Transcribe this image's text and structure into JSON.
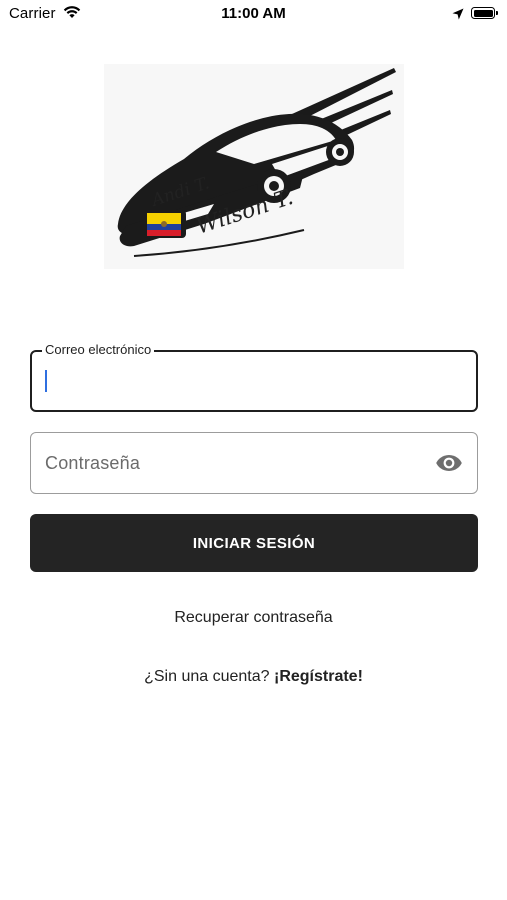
{
  "status_bar": {
    "carrier": "Carrier",
    "time": "11:00 AM",
    "icons": [
      "wifi-icon",
      "location-arrow-icon",
      "battery-icon"
    ]
  },
  "logo": {
    "line1": "Andi T.",
    "line2": "Wilson T.",
    "flag_colors": [
      "#f5d000",
      "#1f3f9c",
      "#d81e2a"
    ]
  },
  "form": {
    "email": {
      "label": "Correo electrónico",
      "value": ""
    },
    "password": {
      "placeholder": "Contraseña",
      "toggle_icon": "eye-icon"
    },
    "submit_label": "INICIAR SESIÓN",
    "recover_label": "Recuperar contraseña",
    "signup_prompt": "¿Sin una cuenta?",
    "signup_link": "¡Regístrate!"
  },
  "colors": {
    "button_bg": "#242424",
    "caret": "#2f6fe0"
  }
}
